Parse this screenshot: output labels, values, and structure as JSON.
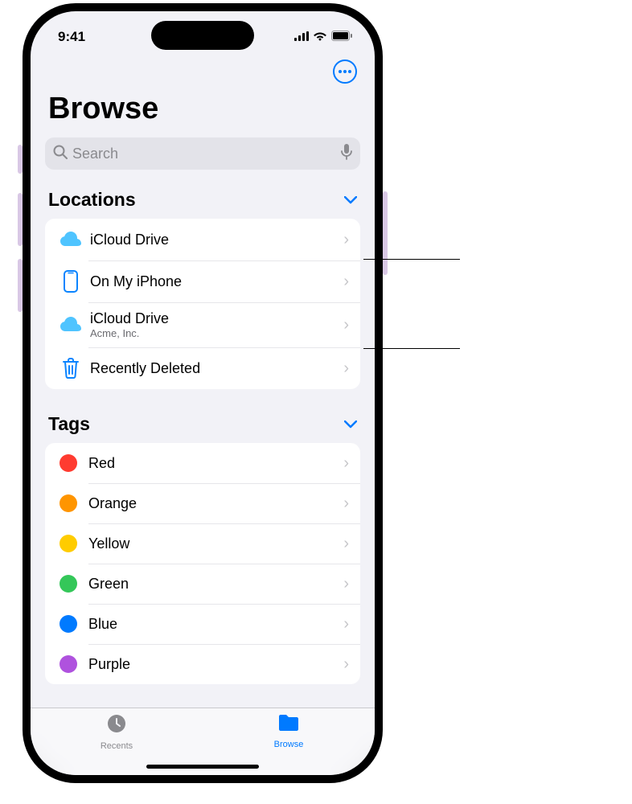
{
  "status": {
    "time": "9:41"
  },
  "page": {
    "title": "Browse"
  },
  "search": {
    "placeholder": "Search"
  },
  "sections": {
    "locations": {
      "header": "Locations",
      "items": [
        {
          "label": "iCloud Drive",
          "sub": "",
          "icon": "cloud-blue"
        },
        {
          "label": "On My iPhone",
          "sub": "",
          "icon": "iphone"
        },
        {
          "label": "iCloud Drive",
          "sub": "Acme, Inc.",
          "icon": "cloud-blue"
        },
        {
          "label": "Recently Deleted",
          "sub": "",
          "icon": "trash"
        }
      ]
    },
    "tags": {
      "header": "Tags",
      "items": [
        {
          "label": "Red",
          "color": "#ff3b30"
        },
        {
          "label": "Orange",
          "color": "#ff9500"
        },
        {
          "label": "Yellow",
          "color": "#ffcc00"
        },
        {
          "label": "Green",
          "color": "#34c759"
        },
        {
          "label": "Blue",
          "color": "#007aff"
        },
        {
          "label": "Purple",
          "color": "#af52de"
        }
      ]
    }
  },
  "tabs": {
    "recents": "Recents",
    "browse": "Browse"
  }
}
